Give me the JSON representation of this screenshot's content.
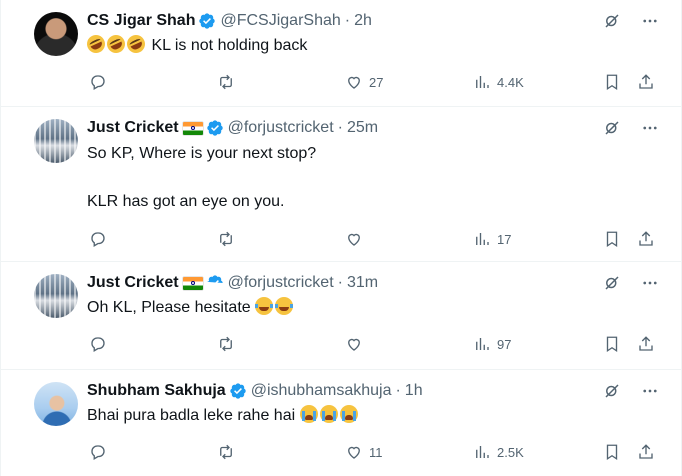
{
  "tweets": [
    {
      "name": "CS Jigar Shah",
      "handle": "@FCSJigarShah",
      "separator": "·",
      "time": "2h",
      "text": "KL is not holding back",
      "emojis": [
        "rolling-on-floor-laughing",
        "rolling-on-floor-laughing",
        "rolling-on-floor-laughing"
      ],
      "replies": "",
      "reposts": "",
      "likes": "27",
      "views": "4.4K"
    },
    {
      "name": "Just Cricket",
      "handle": "@forjustcricket",
      "separator": "·",
      "time": "25m",
      "text": "So KP, Where is your next stop?\n\nKLR has got an eye on you.",
      "emojis": [],
      "replies": "",
      "reposts": "",
      "likes": "",
      "views": "17"
    },
    {
      "name": "Just Cricket",
      "handle": "@forjustcricket",
      "separator": "·",
      "time": "31m",
      "text": "Oh KL, Please hesitate",
      "emojis": [
        "face-with-tears-of-joy",
        "face-with-tears-of-joy"
      ],
      "replies": "",
      "reposts": "",
      "likes": "",
      "views": "97"
    },
    {
      "name": "Shubham Sakhuja",
      "handle": "@ishubhamsakhuja",
      "separator": "·",
      "time": "1h",
      "text": "Bhai pura badla leke rahe hai",
      "emojis": [
        "loudly-crying-face",
        "loudly-crying-face",
        "loudly-crying-face"
      ],
      "replies": "",
      "reposts": "",
      "likes": "11",
      "views": "2.5K"
    }
  ],
  "colors": {
    "text": "#0f1419",
    "muted": "#536471",
    "verified": "#1d9bf0",
    "divider": "#eff3f4"
  }
}
